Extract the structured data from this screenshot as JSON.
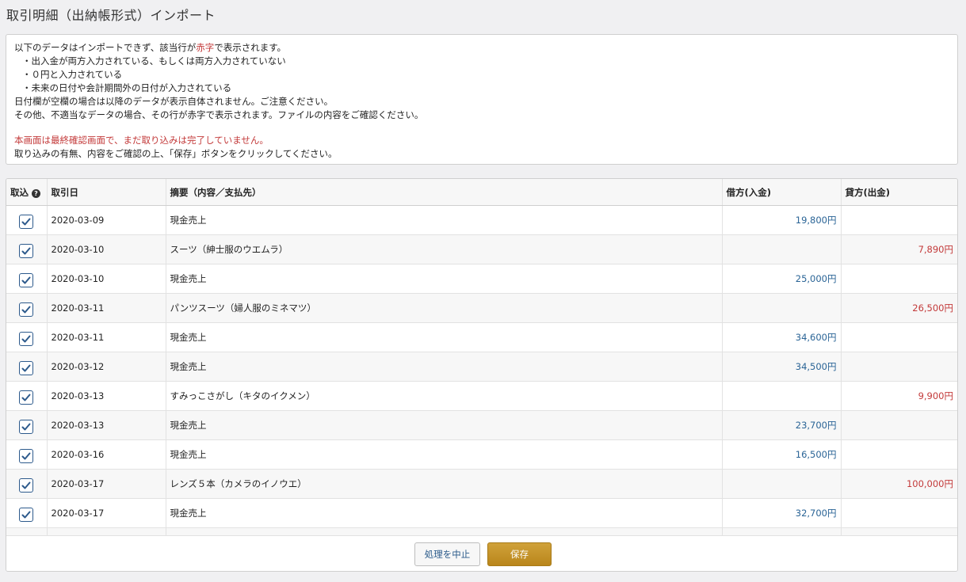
{
  "page": {
    "title": "取引明細（出納帳形式）インポート"
  },
  "notice": {
    "line1_pre": "以下のデータはインポートできず、該当行が",
    "line1_red": "赤字",
    "line1_post": "で表示されます。",
    "bullets": [
      "・出入金が両方入力されている、もしくは両方入力されていない",
      "・０円と入力されている",
      "・未来の日付や会計期間外の日付が入力されている"
    ],
    "line_blank_date": "日付欄が空欄の場合は以降のデータが表示自体されません。ご注意ください。",
    "line_other": "その他、不適当なデータの場合、その行が赤字で表示されます。ファイルの内容をご確認ください。",
    "warning_red": "本画面は最終確認画面で、まだ取り込みは完了していません。",
    "instruction": "取り込みの有無、内容をご確認の上、「保存」ボタンをクリックしてください。"
  },
  "table": {
    "headers": {
      "import": "取込",
      "date": "取引日",
      "description": "摘要（内容／支払先）",
      "debit": "借方(入金)",
      "credit": "貸方(出金)"
    },
    "help_icon": "question-circle-icon",
    "rows": [
      {
        "checked": true,
        "date": "2020-03-09",
        "description": "現金売上",
        "debit": "19,800円",
        "credit": ""
      },
      {
        "checked": true,
        "date": "2020-03-10",
        "description": "スーツ（紳士服のウエムラ）",
        "debit": "",
        "credit": "7,890円"
      },
      {
        "checked": true,
        "date": "2020-03-10",
        "description": "現金売上",
        "debit": "25,000円",
        "credit": ""
      },
      {
        "checked": true,
        "date": "2020-03-11",
        "description": "パンツスーツ（婦人服のミネマツ）",
        "debit": "",
        "credit": "26,500円"
      },
      {
        "checked": true,
        "date": "2020-03-11",
        "description": "現金売上",
        "debit": "34,600円",
        "credit": ""
      },
      {
        "checked": true,
        "date": "2020-03-12",
        "description": "現金売上",
        "debit": "34,500円",
        "credit": ""
      },
      {
        "checked": true,
        "date": "2020-03-13",
        "description": "すみっこさがし（キタのイクメン）",
        "debit": "",
        "credit": "9,900円"
      },
      {
        "checked": true,
        "date": "2020-03-13",
        "description": "現金売上",
        "debit": "23,700円",
        "credit": ""
      },
      {
        "checked": true,
        "date": "2020-03-16",
        "description": "現金売上",
        "debit": "16,500円",
        "credit": ""
      },
      {
        "checked": true,
        "date": "2020-03-17",
        "description": "レンズ５本（カメラのイノウエ）",
        "debit": "",
        "credit": "100,000円"
      },
      {
        "checked": true,
        "date": "2020-03-17",
        "description": "現金売上",
        "debit": "32,700円",
        "credit": ""
      },
      {
        "checked": true,
        "date": "",
        "description": "",
        "debit": "",
        "credit": ""
      }
    ]
  },
  "buttons": {
    "cancel": "処理を中止",
    "save": "保存"
  },
  "colors": {
    "debit": "#2a6496",
    "credit": "#c33a3a",
    "save_button": "#c4942a",
    "checkbox": "#2d5a8c"
  }
}
